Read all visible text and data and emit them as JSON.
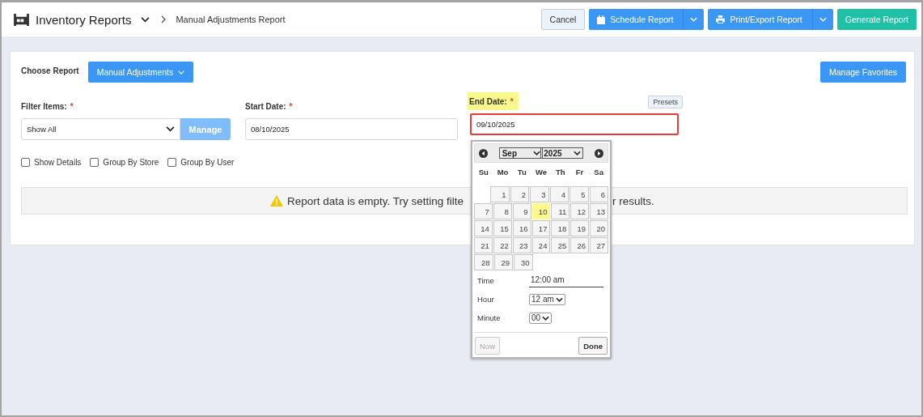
{
  "header": {
    "title": "Inventory Reports",
    "breadcrumb": "Manual Adjustments Report",
    "buttons": [
      {
        "kind": "plain",
        "label": "Cancel"
      },
      {
        "kind": "schedule",
        "label": "Schedule Report"
      },
      {
        "kind": "print",
        "label": "Print/Export Report"
      },
      {
        "kind": "primary",
        "label": "Generate Report"
      }
    ]
  },
  "report": {
    "label": "Choose Report",
    "selected_report": "Manual Adjustments",
    "favorites_button": "Manage Favorites"
  },
  "filters": {
    "filter_items": {
      "label": "Filter Items:",
      "required_mark": "*",
      "value": "Show All",
      "manage_button": "Manage"
    },
    "start_date": {
      "label": "Start Date:",
      "required_mark": "*",
      "value": "08/10/2025"
    },
    "end_date": {
      "label": "End Date:",
      "required_mark": "*",
      "highlighted": true,
      "value": "09/10/2025",
      "presets_button": "Presets"
    }
  },
  "options": [
    {
      "label": "Show Details",
      "checked": false
    },
    {
      "label": "Group By Store",
      "checked": false
    },
    {
      "label": "Group By User",
      "checked": false
    }
  ],
  "notice": {
    "text_start": "Report data is empty. Try setting filte",
    "text_end": "r results."
  },
  "datepicker": {
    "month": "Sep",
    "year": "2025",
    "weekdays": [
      "Su",
      "Mo",
      "Tu",
      "We",
      "Th",
      "Fr",
      "Sa"
    ],
    "weeks": [
      [
        {
          "day": "1",
          "selected": false
        },
        {
          "day": "2",
          "selected": false
        },
        {
          "day": "3",
          "selected": false
        },
        {
          "day": "4",
          "selected": false
        },
        {
          "day": "5",
          "selected": false
        },
        {
          "day": "6",
          "selected": false
        }
      ],
      [
        {
          "day": "7",
          "selected": false
        },
        {
          "day": "8",
          "selected": false
        },
        {
          "day": "9",
          "selected": false
        },
        {
          "day": "10",
          "selected": true
        },
        {
          "day": "11",
          "selected": false
        },
        {
          "day": "12",
          "selected": false
        },
        {
          "day": "13",
          "selected": false
        }
      ],
      [
        {
          "day": "14",
          "selected": false
        },
        {
          "day": "15",
          "selected": false
        },
        {
          "day": "16",
          "selected": false
        },
        {
          "day": "17",
          "selected": false
        },
        {
          "day": "18",
          "selected": false
        },
        {
          "day": "19",
          "selected": false
        },
        {
          "day": "20",
          "selected": false
        }
      ],
      [
        {
          "day": "21",
          "selected": false
        },
        {
          "day": "22",
          "selected": false
        },
        {
          "day": "23",
          "selected": false
        },
        {
          "day": "24",
          "selected": false
        },
        {
          "day": "25",
          "selected": false
        },
        {
          "day": "26",
          "selected": false
        },
        {
          "day": "27",
          "selected": false
        }
      ],
      [
        {
          "day": "28",
          "selected": false
        },
        {
          "day": "29",
          "selected": false
        },
        {
          "day": "30",
          "selected": false
        }
      ]
    ],
    "time_label": "Time",
    "time_value": "12:00 am",
    "hour_label": "Hour",
    "hour_value": "12 am",
    "minute_label": "Minute",
    "minute_value": "00",
    "now_button": {
      "label": "Now",
      "disabled": true
    },
    "done_button": {
      "label": "Done",
      "disabled": false
    }
  }
}
